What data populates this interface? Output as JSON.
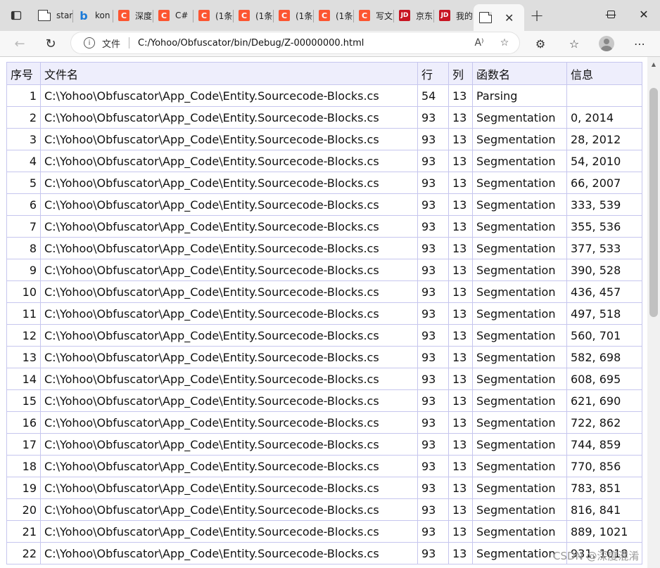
{
  "tabs": [
    {
      "icon": "document-icon",
      "label": "star"
    },
    {
      "icon": "bing-icon",
      "label": "kon"
    },
    {
      "icon": "csdn-icon",
      "label": "深度"
    },
    {
      "icon": "csdn-icon",
      "label": "C#"
    },
    {
      "icon": "csdn-icon",
      "label": "(1条"
    },
    {
      "icon": "csdn-icon",
      "label": "(1条"
    },
    {
      "icon": "csdn-icon",
      "label": "(1条"
    },
    {
      "icon": "csdn-icon",
      "label": "(1条"
    },
    {
      "icon": "csdn-icon",
      "label": "写文"
    },
    {
      "icon": "jd-icon",
      "label": "京东"
    },
    {
      "icon": "jd-icon",
      "label": "我的"
    }
  ],
  "icons": {
    "csdn": "C",
    "jd": "JD",
    "bing": "b"
  },
  "active_tab": {
    "icon": "document-icon"
  },
  "address_bar": {
    "scheme_label": "文件",
    "url": "C:/Yohoo/Obfuscator/bin/Debug/Z-00000000.html"
  },
  "table": {
    "headers": [
      "序号",
      "文件名",
      "行",
      "列",
      "函数名",
      "信息"
    ],
    "rows": [
      [
        "1",
        "C:\\Yohoo\\Obfuscator\\App_Code\\Entity.Sourcecode-Blocks.cs",
        "54",
        "13",
        "Parsing",
        ""
      ],
      [
        "2",
        "C:\\Yohoo\\Obfuscator\\App_Code\\Entity.Sourcecode-Blocks.cs",
        "93",
        "13",
        "Segmentation",
        "0, 2014"
      ],
      [
        "3",
        "C:\\Yohoo\\Obfuscator\\App_Code\\Entity.Sourcecode-Blocks.cs",
        "93",
        "13",
        "Segmentation",
        "28, 2012"
      ],
      [
        "4",
        "C:\\Yohoo\\Obfuscator\\App_Code\\Entity.Sourcecode-Blocks.cs",
        "93",
        "13",
        "Segmentation",
        "54, 2010"
      ],
      [
        "5",
        "C:\\Yohoo\\Obfuscator\\App_Code\\Entity.Sourcecode-Blocks.cs",
        "93",
        "13",
        "Segmentation",
        "66, 2007"
      ],
      [
        "6",
        "C:\\Yohoo\\Obfuscator\\App_Code\\Entity.Sourcecode-Blocks.cs",
        "93",
        "13",
        "Segmentation",
        "333, 539"
      ],
      [
        "7",
        "C:\\Yohoo\\Obfuscator\\App_Code\\Entity.Sourcecode-Blocks.cs",
        "93",
        "13",
        "Segmentation",
        "355, 536"
      ],
      [
        "8",
        "C:\\Yohoo\\Obfuscator\\App_Code\\Entity.Sourcecode-Blocks.cs",
        "93",
        "13",
        "Segmentation",
        "377, 533"
      ],
      [
        "9",
        "C:\\Yohoo\\Obfuscator\\App_Code\\Entity.Sourcecode-Blocks.cs",
        "93",
        "13",
        "Segmentation",
        "390, 528"
      ],
      [
        "10",
        "C:\\Yohoo\\Obfuscator\\App_Code\\Entity.Sourcecode-Blocks.cs",
        "93",
        "13",
        "Segmentation",
        "436, 457"
      ],
      [
        "11",
        "C:\\Yohoo\\Obfuscator\\App_Code\\Entity.Sourcecode-Blocks.cs",
        "93",
        "13",
        "Segmentation",
        "497, 518"
      ],
      [
        "12",
        "C:\\Yohoo\\Obfuscator\\App_Code\\Entity.Sourcecode-Blocks.cs",
        "93",
        "13",
        "Segmentation",
        "560, 701"
      ],
      [
        "13",
        "C:\\Yohoo\\Obfuscator\\App_Code\\Entity.Sourcecode-Blocks.cs",
        "93",
        "13",
        "Segmentation",
        "582, 698"
      ],
      [
        "14",
        "C:\\Yohoo\\Obfuscator\\App_Code\\Entity.Sourcecode-Blocks.cs",
        "93",
        "13",
        "Segmentation",
        "608, 695"
      ],
      [
        "15",
        "C:\\Yohoo\\Obfuscator\\App_Code\\Entity.Sourcecode-Blocks.cs",
        "93",
        "13",
        "Segmentation",
        "621, 690"
      ],
      [
        "16",
        "C:\\Yohoo\\Obfuscator\\App_Code\\Entity.Sourcecode-Blocks.cs",
        "93",
        "13",
        "Segmentation",
        "722, 862"
      ],
      [
        "17",
        "C:\\Yohoo\\Obfuscator\\App_Code\\Entity.Sourcecode-Blocks.cs",
        "93",
        "13",
        "Segmentation",
        "744, 859"
      ],
      [
        "18",
        "C:\\Yohoo\\Obfuscator\\App_Code\\Entity.Sourcecode-Blocks.cs",
        "93",
        "13",
        "Segmentation",
        "770, 856"
      ],
      [
        "19",
        "C:\\Yohoo\\Obfuscator\\App_Code\\Entity.Sourcecode-Blocks.cs",
        "93",
        "13",
        "Segmentation",
        "783, 851"
      ],
      [
        "20",
        "C:\\Yohoo\\Obfuscator\\App_Code\\Entity.Sourcecode-Blocks.cs",
        "93",
        "13",
        "Segmentation",
        "816, 841"
      ],
      [
        "21",
        "C:\\Yohoo\\Obfuscator\\App_Code\\Entity.Sourcecode-Blocks.cs",
        "93",
        "13",
        "Segmentation",
        "889, 1021"
      ],
      [
        "22",
        "C:\\Yohoo\\Obfuscator\\App_Code\\Entity.Sourcecode-Blocks.cs",
        "93",
        "13",
        "Segmentation",
        "931, 1018"
      ]
    ]
  },
  "watermark": "CSDN @深度混淆",
  "colors": {
    "tabstrip_bg": "#dedede",
    "toolbar_bg": "#f7f7f7",
    "table_border": "#c6c6ee",
    "header_bg": "#eeeefc",
    "csdn_red": "#fc5531",
    "jd_red": "#c81623"
  }
}
